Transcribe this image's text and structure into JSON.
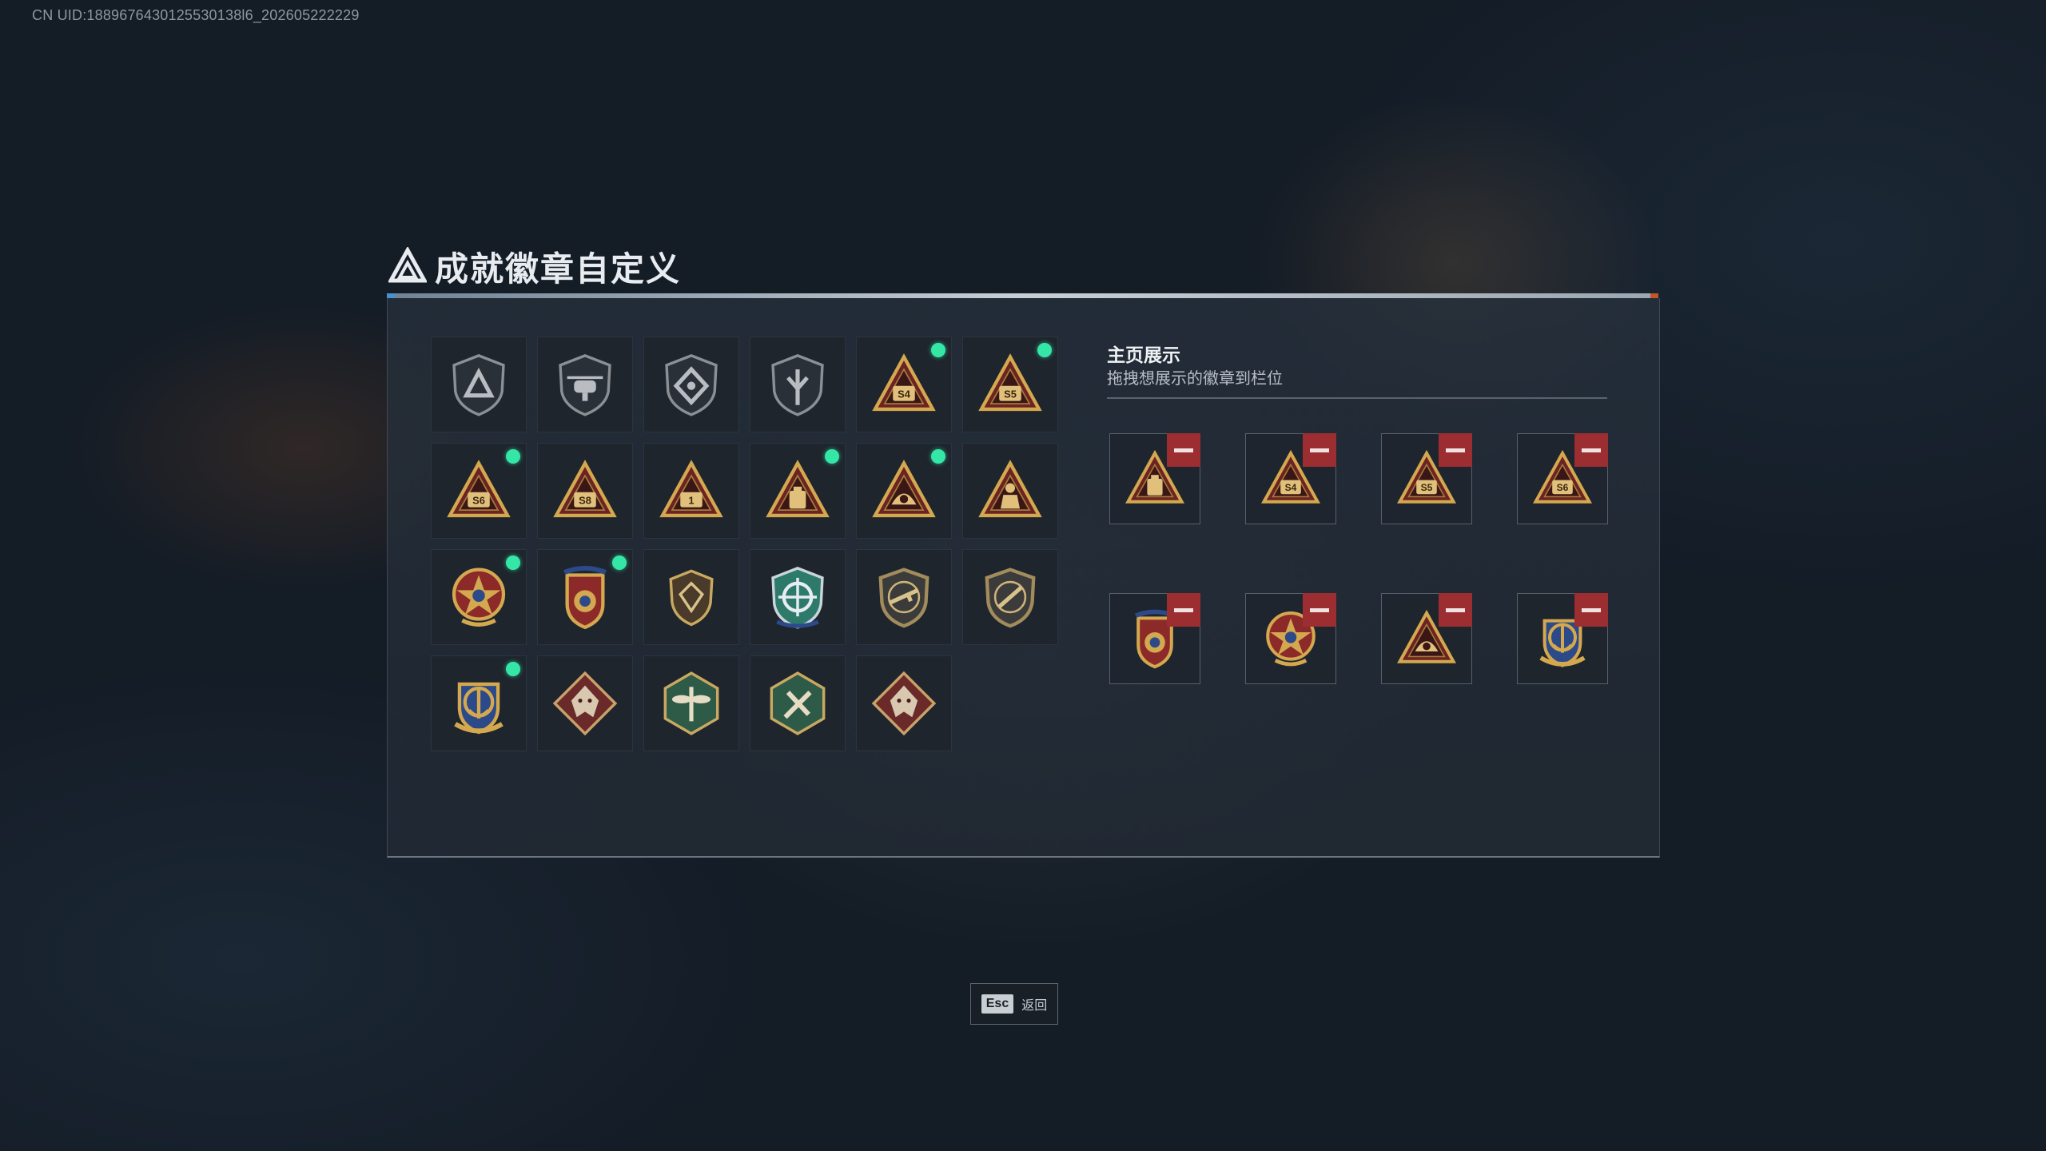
{
  "uid_text": "CN UID:1889676430125530138l6_202605222229",
  "title": "成就徽章自定义",
  "section": {
    "title": "主页展示",
    "subtitle": "拖拽想展示的徽章到栏位"
  },
  "footer": {
    "key": "Esc",
    "label": "返回"
  },
  "badges": [
    {
      "icon": "shield-triangle-icon",
      "new": false
    },
    {
      "icon": "shield-helicopter-icon",
      "new": false
    },
    {
      "icon": "shield-diamond-icon",
      "new": false
    },
    {
      "icon": "shield-arrow-icon",
      "new": false
    },
    {
      "icon": "triangle-s4-icon",
      "label": "S4",
      "new": true
    },
    {
      "icon": "triangle-s5-icon",
      "label": "S5",
      "new": true
    },
    {
      "icon": "triangle-s6-icon",
      "label": "S6",
      "new": true
    },
    {
      "icon": "triangle-s8-icon",
      "label": "S8",
      "new": false
    },
    {
      "icon": "triangle-rank1-icon",
      "label": "1",
      "new": false
    },
    {
      "icon": "triangle-bag-icon",
      "new": true
    },
    {
      "icon": "triangle-helmet-icon",
      "new": true
    },
    {
      "icon": "triangle-soldier-icon",
      "new": false
    },
    {
      "icon": "star-medal-icon",
      "new": true
    },
    {
      "icon": "crest-medal-icon",
      "new": true
    },
    {
      "icon": "gem-shield-icon",
      "new": false
    },
    {
      "icon": "crosshair-shield-icon",
      "new": false
    },
    {
      "icon": "rifle-shield-icon",
      "new": false
    },
    {
      "icon": "knife-shield-icon",
      "new": false
    },
    {
      "icon": "anchor-crest-icon",
      "new": true
    },
    {
      "icon": "wolf-diamond-icon",
      "new": false
    },
    {
      "icon": "dragonfly-hexagon-icon",
      "new": false
    },
    {
      "icon": "tools-hexagon-icon",
      "new": false
    },
    {
      "icon": "dragon-diamond-icon",
      "new": false
    }
  ],
  "showcase": [
    {
      "icon": "triangle-bag-icon"
    },
    {
      "icon": "triangle-s4-icon",
      "label": "S4"
    },
    {
      "icon": "triangle-s5-icon",
      "label": "S5"
    },
    {
      "icon": "triangle-s6-icon",
      "label": "S6"
    },
    {
      "icon": "crest-medal-icon"
    },
    {
      "icon": "star-medal-icon"
    },
    {
      "icon": "triangle-helmet-icon"
    },
    {
      "icon": "anchor-crest-icon"
    }
  ],
  "colors": {
    "accent": "#35e7a6",
    "remove": "#9c2d31",
    "gold": "#d4a84e",
    "crimson": "#6b2323",
    "panel": "#26303c"
  }
}
